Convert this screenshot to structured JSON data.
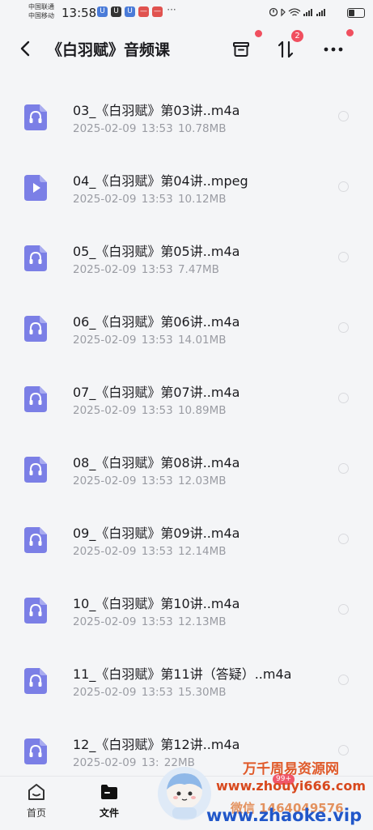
{
  "status_bar": {
    "carrier_1": "中国联通",
    "carrier_2": "中国移动",
    "time": "13:58",
    "notif_more": "···"
  },
  "header": {
    "title": "《白羽赋》音频课",
    "sort_badge": "2"
  },
  "files": [
    {
      "name": "03_《白羽赋》第03讲..m4a",
      "date": "2025-02-09",
      "time": "13:53",
      "size": "10.78MB",
      "type": "audio"
    },
    {
      "name": "04_《白羽赋》第04讲..mpeg",
      "date": "2025-02-09",
      "time": "13:53",
      "size": "10.12MB",
      "type": "video"
    },
    {
      "name": "05_《白羽赋》第05讲..m4a",
      "date": "2025-02-09",
      "time": "13:53",
      "size": "7.47MB",
      "type": "audio"
    },
    {
      "name": "06_《白羽赋》第06讲..m4a",
      "date": "2025-02-09",
      "time": "13:53",
      "size": "14.01MB",
      "type": "audio"
    },
    {
      "name": "07_《白羽赋》第07讲..m4a",
      "date": "2025-02-09",
      "time": "13:53",
      "size": "10.89MB",
      "type": "audio"
    },
    {
      "name": "08_《白羽赋》第08讲..m4a",
      "date": "2025-02-09",
      "time": "13:53",
      "size": "12.03MB",
      "type": "audio"
    },
    {
      "name": "09_《白羽赋》第09讲..m4a",
      "date": "2025-02-09",
      "time": "13:53",
      "size": "12.14MB",
      "type": "audio"
    },
    {
      "name": "10_《白羽赋》第10讲..m4a",
      "date": "2025-02-09",
      "time": "13:53",
      "size": "12.13MB",
      "type": "audio"
    },
    {
      "name": "11_《白羽赋》第11讲（答疑）..m4a",
      "date": "2025-02-09",
      "time": "13:53",
      "size": "15.30MB",
      "type": "audio"
    },
    {
      "name": "12_《白羽赋》第12讲..m4a",
      "date": "2025-02-09",
      "time": "13:",
      "size": "22MB",
      "type": "audio"
    }
  ],
  "bottom_nav": {
    "home_label": "首页",
    "files_label": "文件"
  },
  "watermark": {
    "line1": "万千周易资源网",
    "line2": "www.zhouyi666.com",
    "line3": "微信 1464049576",
    "line4": "www.zhaoke.vip",
    "badge": "99+"
  },
  "colors": {
    "accent": "#7b7fe6",
    "notification_dot": "#f04f5f",
    "meta_text": "#9a9ca3"
  }
}
